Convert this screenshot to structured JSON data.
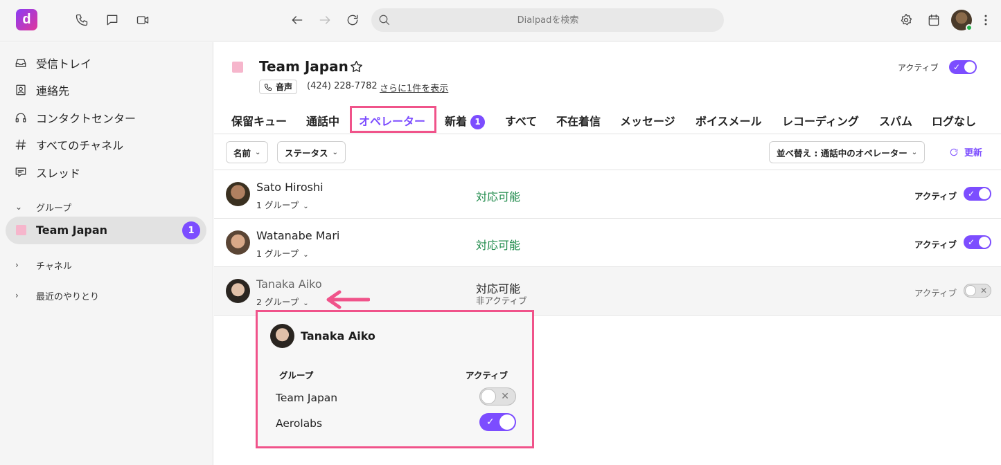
{
  "topbar": {
    "logo_letter": "d",
    "search_placeholder": "Dialpadを検索",
    "icons": [
      "phone-icon",
      "chat-icon",
      "video-icon",
      "back-arrow-icon",
      "forward-arrow-icon",
      "reload-icon",
      "search-icon",
      "gear-icon",
      "calendar-icon",
      "more-vertical-icon"
    ]
  },
  "sidebar": {
    "items": [
      {
        "label": "受信トレイ",
        "icon": "inbox-icon"
      },
      {
        "label": "連絡先",
        "icon": "contacts-icon"
      },
      {
        "label": "コンタクトセンター",
        "icon": "headset-icon"
      },
      {
        "label": "すべてのチャネル",
        "icon": "hash-icon"
      },
      {
        "label": "スレッド",
        "icon": "thread-icon"
      }
    ],
    "groups_label": "グループ",
    "selected_team": {
      "label": "Team Japan",
      "badge": "1"
    },
    "channels_label": "チャネル",
    "recent_label": "最近のやりとり"
  },
  "header": {
    "title": "Team Japan",
    "voice_label": "音声",
    "phone": "(424) 228-7782",
    "more_link": "さらに1件を表示",
    "active_label": "アクティブ",
    "active_on": true
  },
  "tabs": [
    {
      "label": "保留キュー"
    },
    {
      "label": "通話中"
    },
    {
      "label": "オペレーター",
      "selected": true
    },
    {
      "label": "新着",
      "badge": "1"
    },
    {
      "label": "すべて"
    },
    {
      "label": "不在着信"
    },
    {
      "label": "メッセージ"
    },
    {
      "label": "ボイスメール"
    },
    {
      "label": "レコーディング"
    },
    {
      "label": "スパム"
    },
    {
      "label": "ログなし"
    }
  ],
  "filters": {
    "name": "名前",
    "status": "ステータス",
    "sort": "並べ替え : 通話中のオペレーター",
    "refresh": "更新"
  },
  "operators": [
    {
      "name": "Sato Hiroshi",
      "groups": "1 グループ",
      "status": "対応可能",
      "sub": "",
      "active_label": "アクティブ",
      "active": true
    },
    {
      "name": "Watanabe Mari",
      "groups": "1 グループ",
      "status": "対応可能",
      "sub": "",
      "active_label": "アクティブ",
      "active": true
    },
    {
      "name": "Tanaka Aiko",
      "groups": "2 グループ",
      "status": "対応可能",
      "sub": "非アクティブ",
      "active_label": "アクティブ",
      "active": false
    }
  ],
  "popup": {
    "name": "Tanaka Aiko",
    "col_group": "グループ",
    "col_active": "アクティブ",
    "groups": [
      {
        "name": "Team Japan",
        "active": false
      },
      {
        "name": "Aerolabs",
        "active": true
      }
    ]
  },
  "colors": {
    "accent": "#7c4dff",
    "highlight": "#f0538a",
    "available": "#1e8a4a",
    "team": "#f6b6cc"
  }
}
